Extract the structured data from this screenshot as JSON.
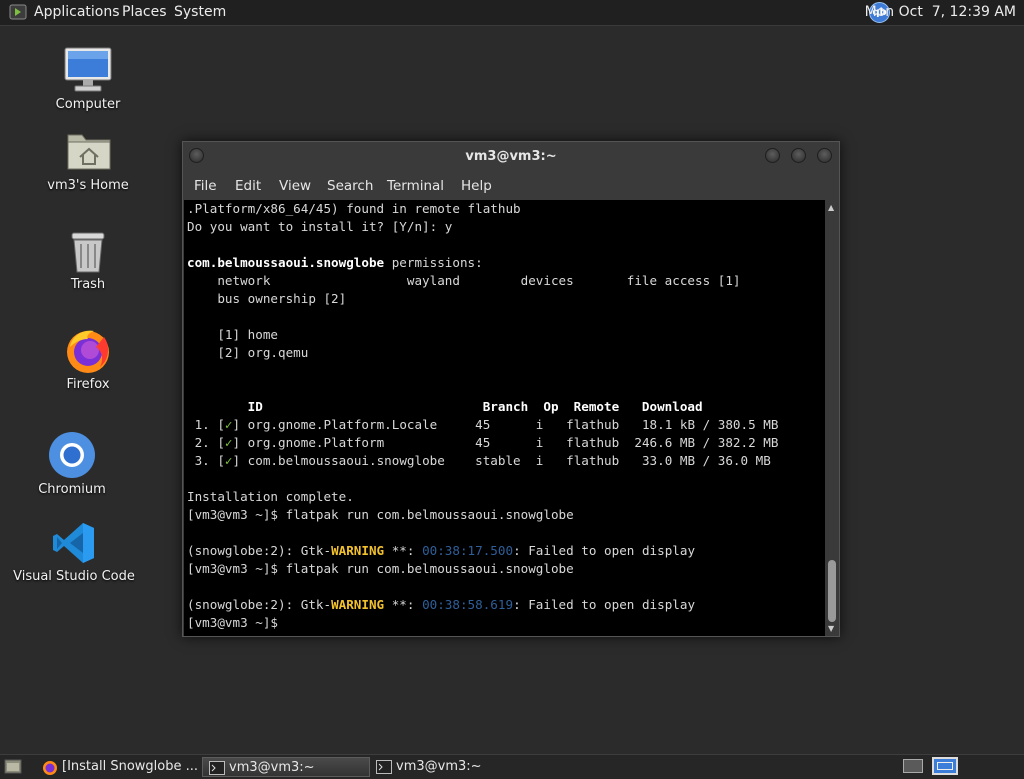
{
  "top_panel": {
    "menus": [
      "Applications",
      "Places",
      "System"
    ],
    "tray_icon": "qb",
    "clock": "Mon Oct  7, 12:39 AM"
  },
  "desktop_icons": [
    {
      "label": "Computer",
      "icon": "computer-icon"
    },
    {
      "label": "vm3's Home",
      "icon": "home-folder-icon"
    },
    {
      "label": "Trash",
      "icon": "trash-icon"
    },
    {
      "label": "Firefox",
      "icon": "firefox-icon"
    },
    {
      "label": "Chromium",
      "icon": "chromium-icon"
    },
    {
      "label": "Visual Studio Code",
      "icon": "vscode-icon"
    }
  ],
  "terminal": {
    "title": "vm3@vm3:~",
    "menu": [
      "File",
      "Edit",
      "View",
      "Search",
      "Terminal",
      "Help"
    ],
    "lines": [
      [
        {
          "t": ".Platform/x86_64/45) found in remote flathub"
        }
      ],
      [
        {
          "t": "Do you want to install it? [Y/n]: y"
        }
      ],
      [
        {
          "t": ""
        }
      ],
      [
        {
          "t": "com.belmoussaoui.snowglobe",
          "s": "b"
        },
        {
          "t": " permissions:"
        }
      ],
      [
        {
          "t": "    network                  wayland        devices       file access [1]"
        }
      ],
      [
        {
          "t": "    bus ownership [2]"
        }
      ],
      [
        {
          "t": ""
        }
      ],
      [
        {
          "t": "    [1] home"
        }
      ],
      [
        {
          "t": "    [2] org.qemu"
        }
      ],
      [
        {
          "t": ""
        }
      ],
      [
        {
          "t": ""
        }
      ],
      [
        {
          "t": "        ID                             Branch  Op  Remote   Download",
          "s": "b"
        }
      ],
      [
        {
          "t": " 1. ["
        },
        {
          "t": "✓",
          "s": "g"
        },
        {
          "t": "] org.gnome.Platform.Locale     45      i   flathub   18.1 kB / 380.5 MB"
        }
      ],
      [
        {
          "t": " 2. ["
        },
        {
          "t": "✓",
          "s": "g"
        },
        {
          "t": "] org.gnome.Platform            45      i   flathub  246.6 MB / 382.2 MB"
        }
      ],
      [
        {
          "t": " 3. ["
        },
        {
          "t": "✓",
          "s": "g"
        },
        {
          "t": "] com.belmoussaoui.snowglobe    stable  i   flathub   33.0 MB / 36.0 MB"
        }
      ],
      [
        {
          "t": ""
        }
      ],
      [
        {
          "t": "Installation complete."
        }
      ],
      [
        {
          "t": "[vm3@vm3 ~]$ flatpak run com.belmoussaoui.snowglobe"
        }
      ],
      [
        {
          "t": ""
        }
      ],
      [
        {
          "t": "(snowglobe:2): Gtk-"
        },
        {
          "t": "WARNING",
          "s": "y"
        },
        {
          "t": " **: "
        },
        {
          "t": "00:38:17.500",
          "s": "c"
        },
        {
          "t": ": Failed to open display"
        }
      ],
      [
        {
          "t": "[vm3@vm3 ~]$ flatpak run com.belmoussaoui.snowglobe"
        }
      ],
      [
        {
          "t": ""
        }
      ],
      [
        {
          "t": "(snowglobe:2): Gtk-"
        },
        {
          "t": "WARNING",
          "s": "y"
        },
        {
          "t": " **: "
        },
        {
          "t": "00:38:58.619",
          "s": "c"
        },
        {
          "t": ": Failed to open display"
        }
      ],
      [
        {
          "t": "[vm3@vm3 ~]$"
        }
      ]
    ]
  },
  "taskbar": {
    "tasks": [
      {
        "label": "[Install Snowglobe ...",
        "icon": "firefox-icon",
        "active": false
      },
      {
        "label": "vm3@vm3:~",
        "icon": "terminal-icon",
        "active": true
      },
      {
        "label": "vm3@vm3:~",
        "icon": "terminal-icon",
        "active": false
      }
    ],
    "workspaces": 2,
    "active_workspace": 2
  },
  "colors": {
    "desktop_bg": "#2b2b2b",
    "panel_bg": "#202020",
    "terminal_bg": "#000000",
    "warning_yellow": "#f2c12e",
    "check_green": "#7fc23f",
    "timestamp_blue": "#2f5f99"
  }
}
